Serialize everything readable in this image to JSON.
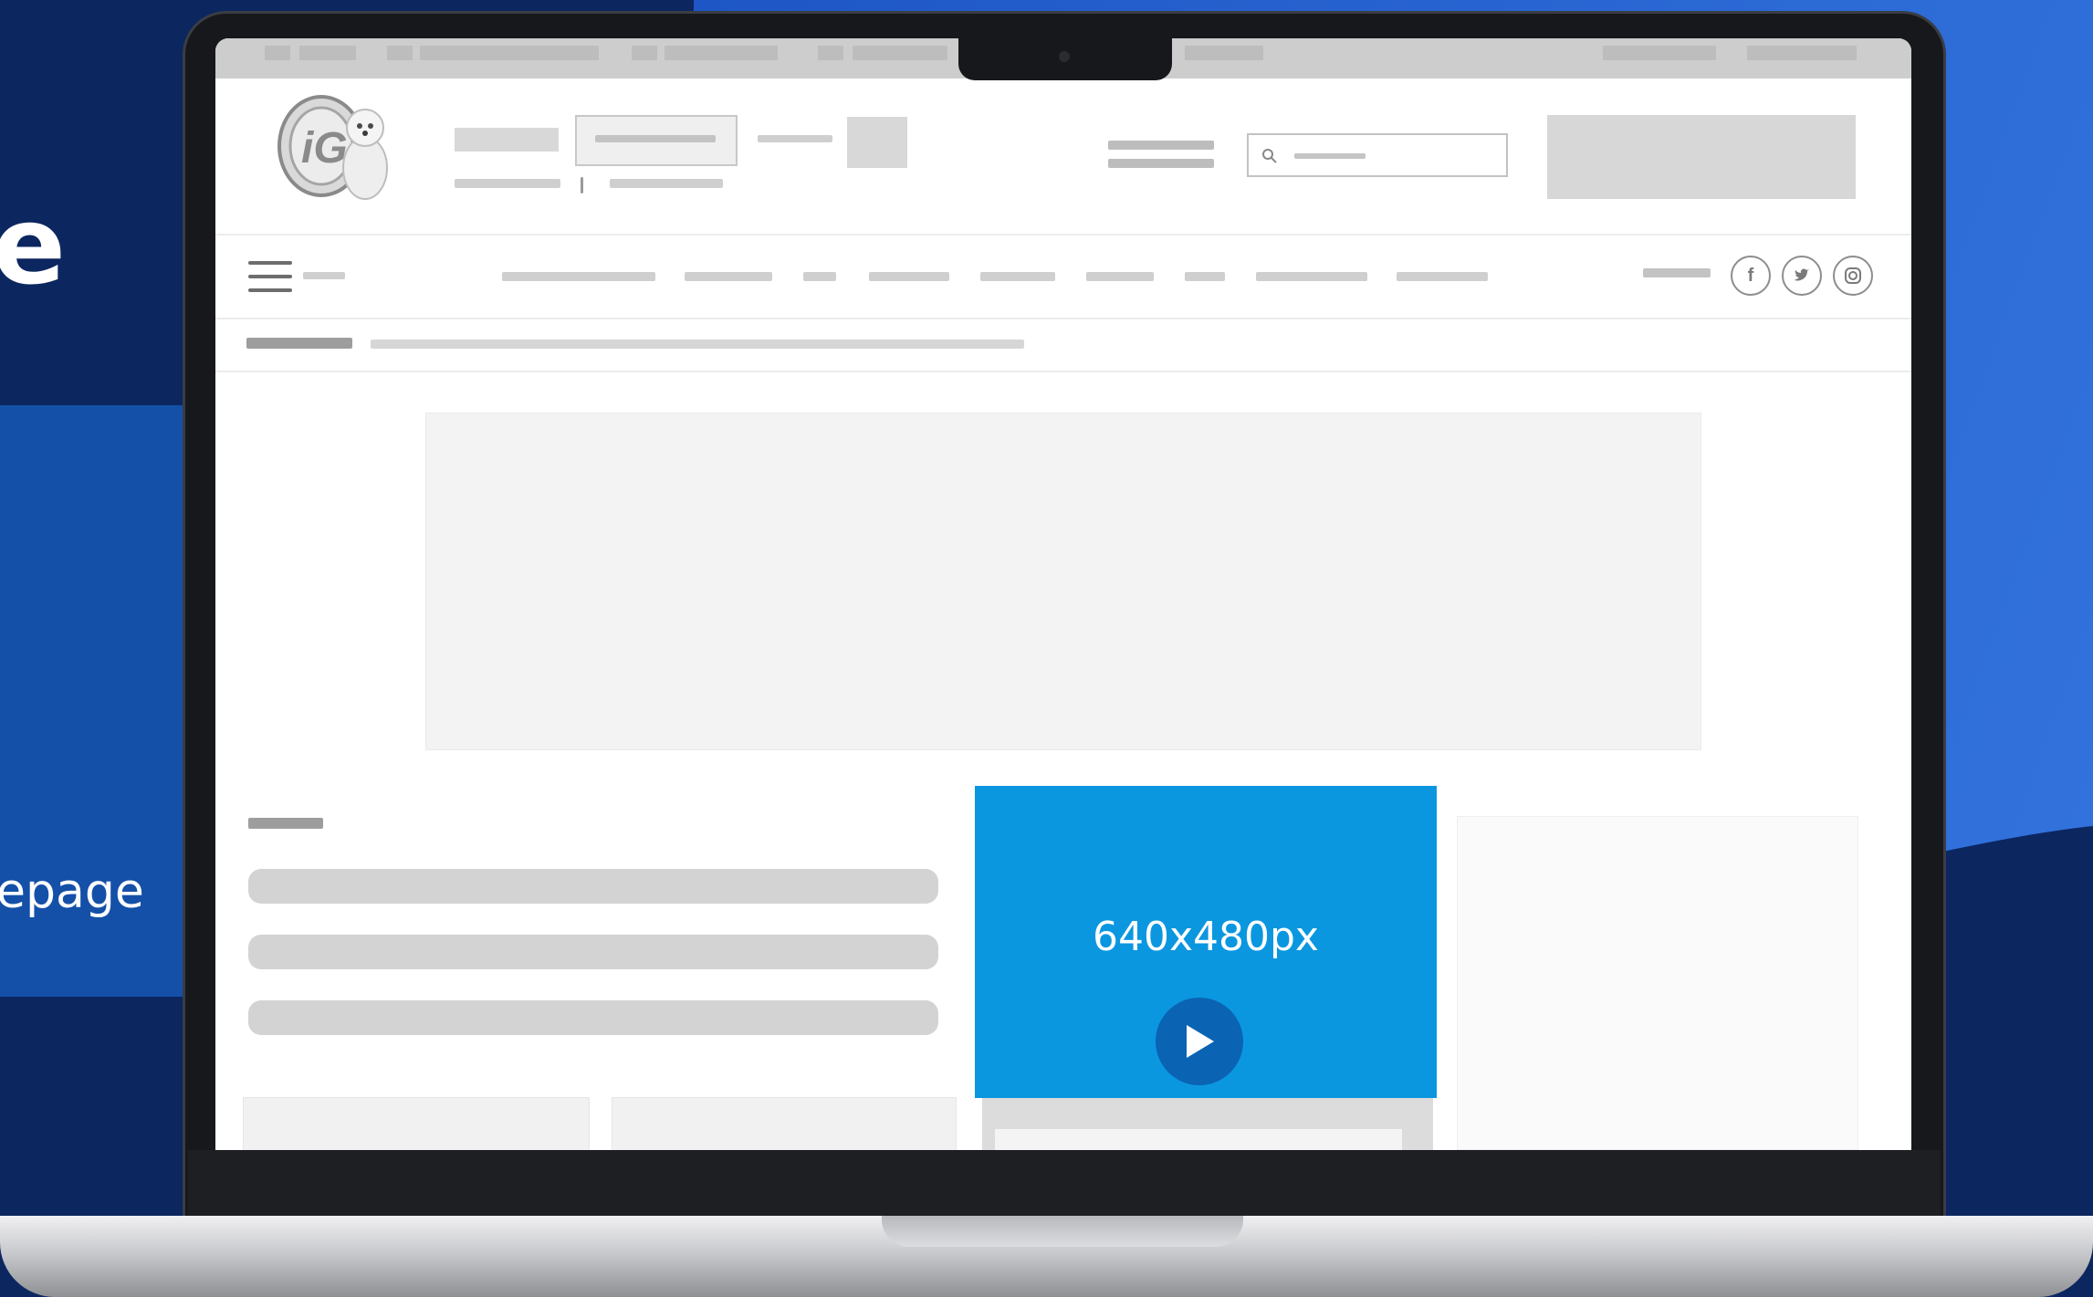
{
  "background": {
    "partial_headline": "e",
    "partial_caption": "epage"
  },
  "video_player": {
    "size_label": "640x480px",
    "play_icon": "play-icon"
  },
  "site_header": {
    "logo_text": "iG",
    "search_icon": "search-icon"
  },
  "social_icons": [
    "facebook-icon",
    "twitter-icon",
    "instagram-icon"
  ],
  "colors": {
    "background_navy": "#0c2660",
    "background_royal": "#2c6ad6",
    "video_blue": "#0b97e0",
    "play_button": "#0a63b3"
  }
}
